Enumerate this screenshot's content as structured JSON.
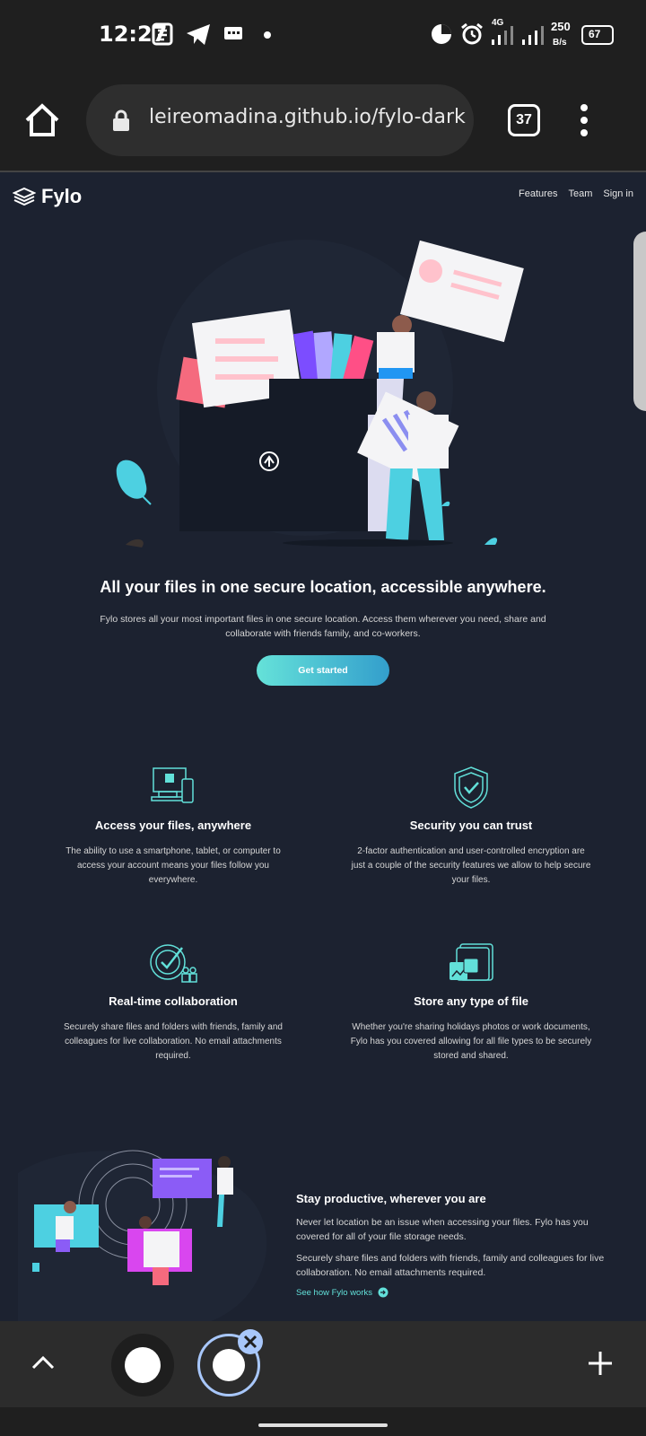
{
  "status_bar": {
    "time": "12:27",
    "network": "4G",
    "speed_value": "250",
    "speed_unit": "B/s",
    "battery": "67"
  },
  "browser": {
    "url": "leireomadina.github.io/fylo-dark",
    "tab_count": "37"
  },
  "site": {
    "logo": "Fylo",
    "nav": [
      "Features",
      "Team",
      "Sign in"
    ],
    "hero": {
      "title": "All your files in one secure location, accessible anywhere.",
      "text": "Fylo stores all your most important files in one secure location. Access them wherever you need, share and collaborate with friends family, and co-workers.",
      "cta": "Get started"
    },
    "features": [
      {
        "icon": "devices-icon",
        "title": "Access your files, anywhere",
        "text": "The ability to use a smartphone, tablet, or computer to access your account means your files follow you everywhere."
      },
      {
        "icon": "shield-icon",
        "title": "Security you can trust",
        "text": "2-factor authentication and user-controlled encryption are just a couple of the security features we allow to help secure your files."
      },
      {
        "icon": "collaboration-icon",
        "title": "Real-time collaboration",
        "text": "Securely share files and folders with friends, family and colleagues for live collaboration. No email attachments required."
      },
      {
        "icon": "folder-files-icon",
        "title": "Store any type of file",
        "text": "Whether you're sharing holidays photos or work documents, Fylo has you covered allowing for all file types to be securely stored and shared."
      }
    ],
    "productive": {
      "title": "Stay productive, wherever you are",
      "p1": "Never let location be an issue when accessing your files. Fylo has you covered for all of your file storage needs.",
      "p2": "Securely share files and folders with friends, family and colleagues for live collaboration. No email attachments required.",
      "link": "See how Fylo works"
    }
  },
  "colors": {
    "page_bg": "#1c2230",
    "accent": "#62e0d9",
    "cta_start": "#65e2d9",
    "cta_end": "#339ecc"
  }
}
